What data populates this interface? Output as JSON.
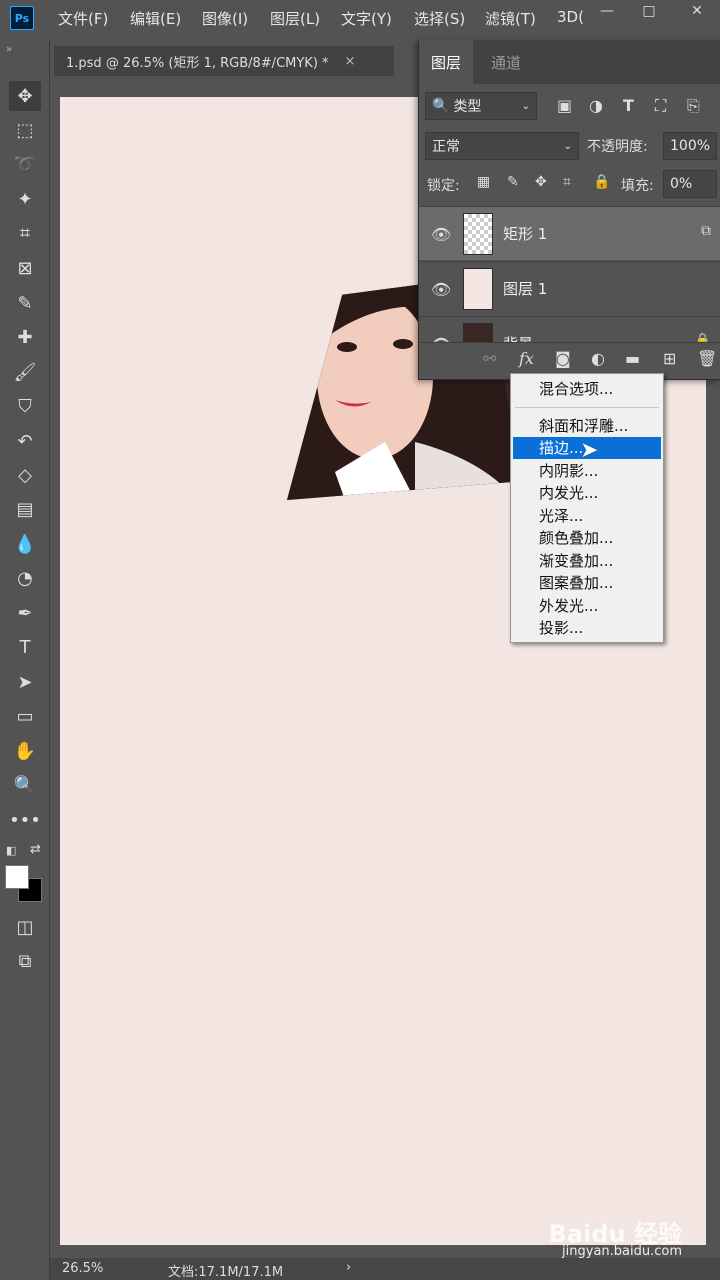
{
  "app": {
    "logo": "Ps"
  },
  "menubar": {
    "items": [
      "文件(F)",
      "编辑(E)",
      "图像(I)",
      "图层(L)",
      "文字(Y)",
      "选择(S)",
      "滤镜(T)",
      "3D("
    ]
  },
  "window_controls": {
    "minimize": "—",
    "maximize": "□",
    "close": "✕"
  },
  "document_tab": {
    "title": "1.psd @ 26.5% (矩形 1, RGB/8#/CMYK) *",
    "close": "×"
  },
  "layers_panel": {
    "tabs": [
      "图层",
      "通道"
    ],
    "filter_kind": "类型",
    "blend_mode": "正常",
    "opacity_label": "不透明度:",
    "opacity_value": "100%",
    "lock_label": "锁定:",
    "fill_label": "填充:",
    "fill_value": "0%",
    "layers": [
      {
        "name": "矩形 1",
        "selected": true
      },
      {
        "name": "图层 1",
        "selected": false
      },
      {
        "name": "背景",
        "selected": false
      }
    ]
  },
  "fx_menu": {
    "items": [
      "混合选项...",
      "斜面和浮雕...",
      "描边...",
      "内阴影...",
      "内发光...",
      "光泽...",
      "颜色叠加...",
      "渐变叠加...",
      "图案叠加...",
      "外发光...",
      "投影..."
    ],
    "highlighted": "描边..."
  },
  "statusbar": {
    "zoom": "26.5%",
    "doc_info": "文档:17.1M/17.1M",
    "arrow": "›"
  },
  "watermark": {
    "brand": "Baidu 经验",
    "url": "jingyan.baidu.com"
  },
  "colors": {
    "canvas": "#f3e5e1",
    "highlight": "#0a70d7",
    "ui_bg": "#535353"
  }
}
